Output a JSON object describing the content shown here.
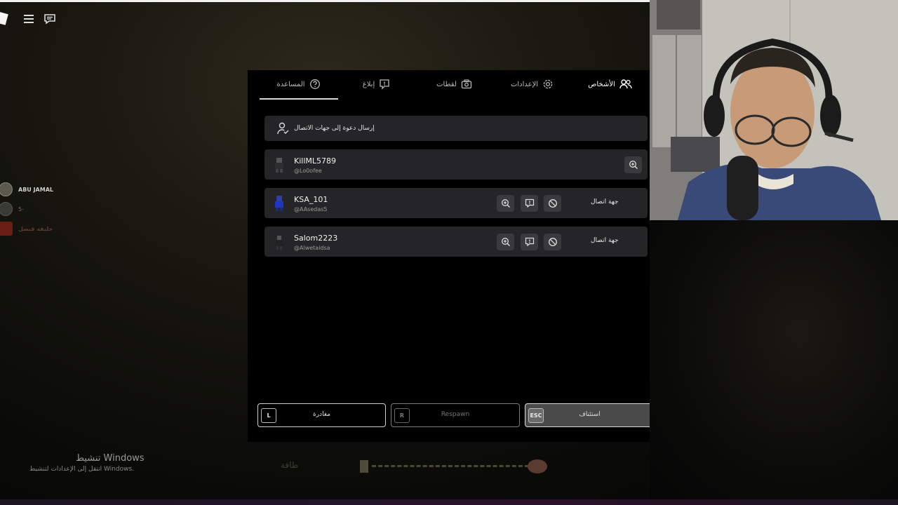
{
  "tabs": [
    {
      "label": "الأشخاص",
      "icon": "people-icon",
      "active": true
    },
    {
      "label": "الإعدادات",
      "icon": "gear-icon",
      "active": false
    },
    {
      "label": "لقطات",
      "icon": "camera-icon",
      "active": false
    },
    {
      "label": "إبلاغ",
      "icon": "report-flag-icon",
      "active": false
    },
    {
      "label": "المساعدة",
      "icon": "help-circle-icon",
      "active": false
    }
  ],
  "invite": {
    "label": "إرسال دعوة إلى جهات الاتصال"
  },
  "players": [
    {
      "name": "KillML5789",
      "handle": "@Lo0ofee",
      "is_self": true
    },
    {
      "name": "KSA_101",
      "handle": "@AAsedas5",
      "contact_label": "جهة اتصال"
    },
    {
      "name": "Salom2223",
      "handle": "@Alwetaidsa",
      "contact_label": "جهة اتصال"
    }
  ],
  "side_list": [
    {
      "name": "ABU JAMAL"
    },
    {
      "name": "5-"
    },
    {
      "name": "خليفة فيصل"
    }
  ],
  "bottom_buttons": {
    "leave": {
      "key": "L",
      "label": "مغادرة"
    },
    "respawn": {
      "key": "R",
      "label": "Respawn"
    },
    "resume": {
      "key": "ESC",
      "label": "استئناف"
    }
  },
  "watermark": {
    "title": "تنشيط Windows",
    "subtitle": "انتقل إلى الإعدادات لتنشيط Windows."
  },
  "hud": {
    "label": "طاقة"
  },
  "colors": {
    "panel": "#000000",
    "row": "#252527",
    "action_button": "#3a3a3c",
    "resume_button": "#4a4a4a"
  }
}
